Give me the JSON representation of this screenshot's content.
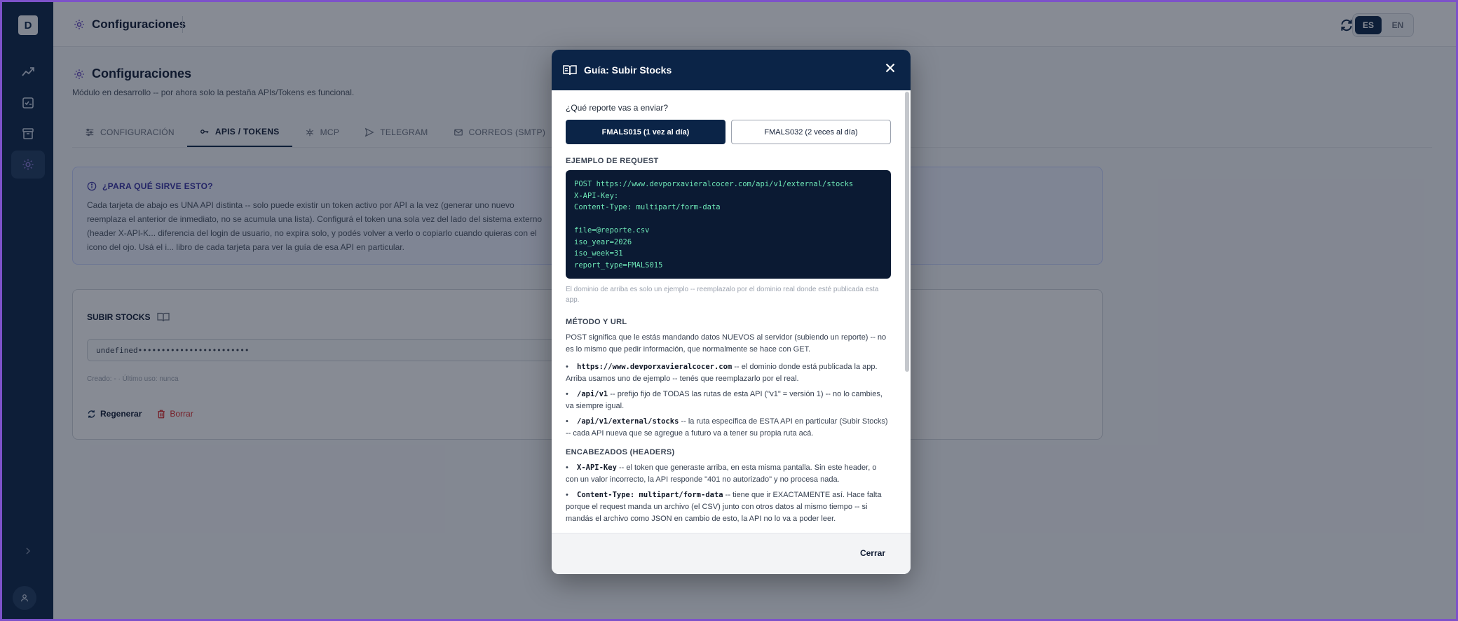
{
  "app": {
    "logo_letter": "D",
    "header_title": "Configuraciones",
    "languages": [
      "ES",
      "EN"
    ],
    "active_language": "ES"
  },
  "page": {
    "title": "Configuraciones",
    "subtitle": "Módulo en desarrollo -- por ahora solo la pestaña APIs/Tokens es funcional.",
    "tabs": [
      {
        "label": "CONFIGURACIÓN",
        "icon": "sliders-icon"
      },
      {
        "label": "APIS / TOKENS",
        "icon": "key-icon",
        "active": true
      },
      {
        "label": "MCP",
        "icon": "network-icon"
      },
      {
        "label": "TELEGRAM",
        "icon": "send-icon"
      },
      {
        "label": "CORREOS (SMTP)",
        "icon": "mail-icon"
      }
    ]
  },
  "info": {
    "title": "¿PARA QUÉ SIRVE ESTO?",
    "text": "Cada tarjeta de abajo es UNA API distinta -- solo puede existir un token activo por API a la vez (generar uno nuevo reemplaza el anterior de inmediato, no se acumula una lista). Configurá el token una sola vez del lado del sistema externo (header X-API-K... diferencia del login de usuario, no expira solo, y podés volver a verlo o copiarlo cuando quieras con el icono del ojo. Usá el i... libro de cada tarjeta para ver la guía de esa API en particular."
  },
  "card": {
    "title": "SUBIR STOCKS",
    "token_value": "undefined••••••••••••••••••••••••",
    "created": "Creado: - · Último uso: nunca",
    "regenerate_label": "Regenerar",
    "delete_label": "Borrar"
  },
  "modal": {
    "title": "Guía: Subir Stocks",
    "question": "¿Qué reporte vas a enviar?",
    "options": [
      "FMALS015 (1 vez al día)",
      "FMALS032 (2 veces al día)"
    ],
    "selected_option": "FMALS015 (1 vez al día)",
    "request_heading": "EJEMPLO DE REQUEST",
    "code_lines": [
      "POST https://www.devporxavieralcocer.com/api/v1/external/stocks",
      "X-API-Key:",
      "Content-Type: multipart/form-data",
      "",
      "file=@reporte.csv",
      "iso_year=2026",
      "iso_week=31",
      "report_type=FMALS015"
    ],
    "domain_note": "El dominio de arriba es solo un ejemplo -- reemplazalo por el dominio real donde esté publicada esta app.",
    "method_heading": "MÉTODO Y URL",
    "method_text": "POST significa que le estás mandando datos NUEVOS al servidor (subiendo un reporte) -- no es lo mismo que pedir información, que normalmente se hace con GET.",
    "url_items": [
      {
        "code": "https://www.devporxavieralcocer.com",
        "text": " -- el dominio donde está publicada la app. Arriba usamos uno de ejemplo -- tenés que reemplazarlo por el real."
      },
      {
        "code": "/api/v1",
        "text": " -- prefijo fijo de TODAS las rutas de esta API (\"v1\" = versión 1) -- no lo cambies, va siempre igual."
      },
      {
        "code": "/api/v1/external/stocks",
        "text": " -- la ruta específica de ESTA API en particular (Subir Stocks) -- cada API nueva que se agregue a futuro va a tener su propia ruta acá."
      }
    ],
    "headers_heading": "ENCABEZADOS (HEADERS)",
    "header_items": [
      {
        "code": "X-API-Key",
        "text": " -- el token que generaste arriba, en esta misma pantalla. Sin este header, o con un valor incorrecto, la API responde \"401 no autorizado\" y no procesa nada."
      },
      {
        "code": "Content-Type: multipart/form-data",
        "text": " -- tiene que ir EXACTAMENTE así. Hace falta porque el request manda un archivo (el CSV) junto con otros datos al mismo tiempo -- si mandás el archivo como JSON en cambio de esto, la API no lo va a poder leer."
      }
    ],
    "close_label": "Cerrar"
  },
  "colors": {
    "navy": "#0b2447",
    "code_bg": "#0b1a33",
    "code_text": "#6ee7b7",
    "danger": "#dc2626",
    "frame": "#7d52c9"
  }
}
